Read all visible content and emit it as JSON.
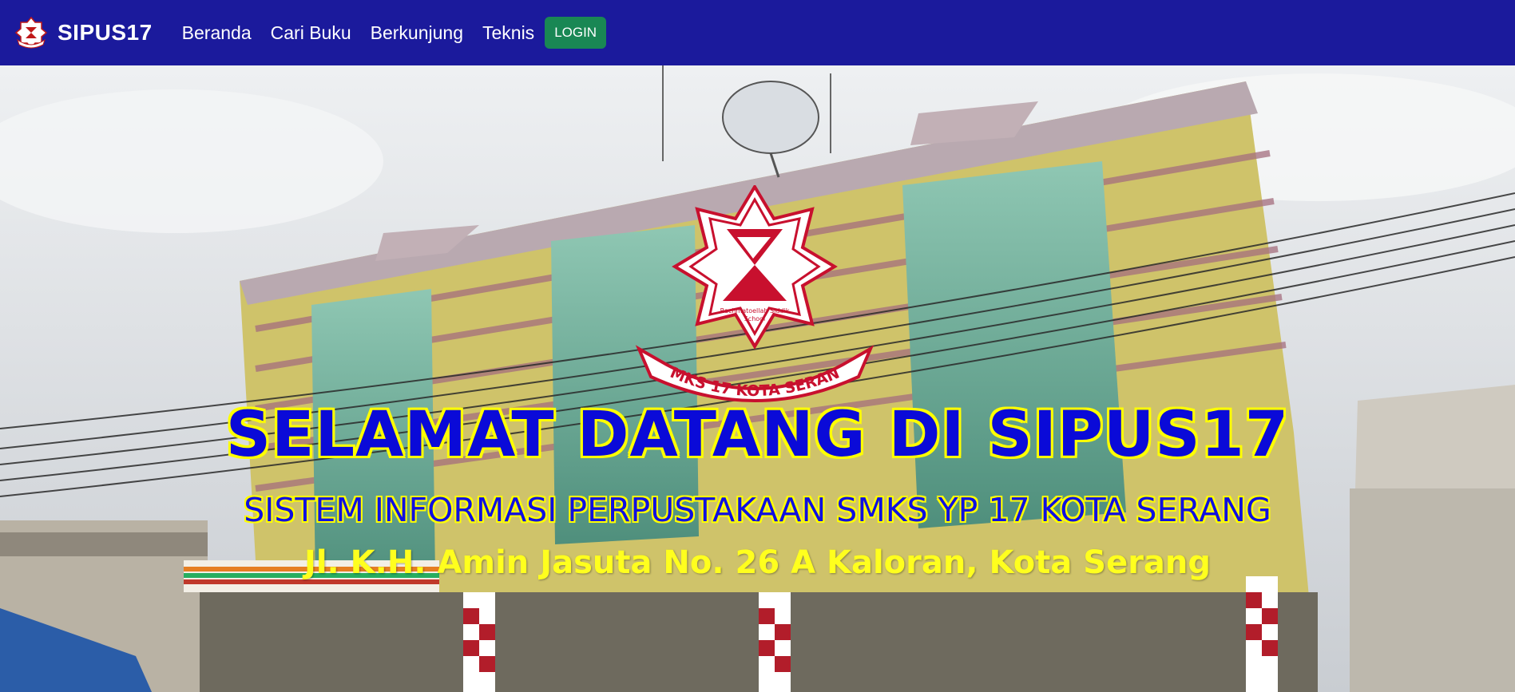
{
  "navbar": {
    "brand": "SIPUS17",
    "links": [
      {
        "label": "Beranda"
      },
      {
        "label": "Cari Buku"
      },
      {
        "label": "Berkunjung"
      },
      {
        "label": "Teknis"
      }
    ],
    "login_label": "LOGIN"
  },
  "hero": {
    "emblem_banner": "SMKS 17 KOTA SERANG",
    "emblem_caption_line1": "Rachmatoellah Siddik",
    "emblem_caption_line2": "School",
    "title": "SELAMAT DATANG DI SIPUS17",
    "subtitle": "SISTEM INFORMASI PERPUSTAKAAN SMKS YP 17 KOTA SERANG",
    "address": "Jl. K.H. Amin Jasuta No. 26 A Kaloran, Kota Serang"
  },
  "colors": {
    "navbar_bg": "#1b1a9c",
    "login_bg": "#198754",
    "title_fill": "#0a0ad8",
    "title_outline": "#ffff00",
    "address_fill": "#ffff1e"
  }
}
